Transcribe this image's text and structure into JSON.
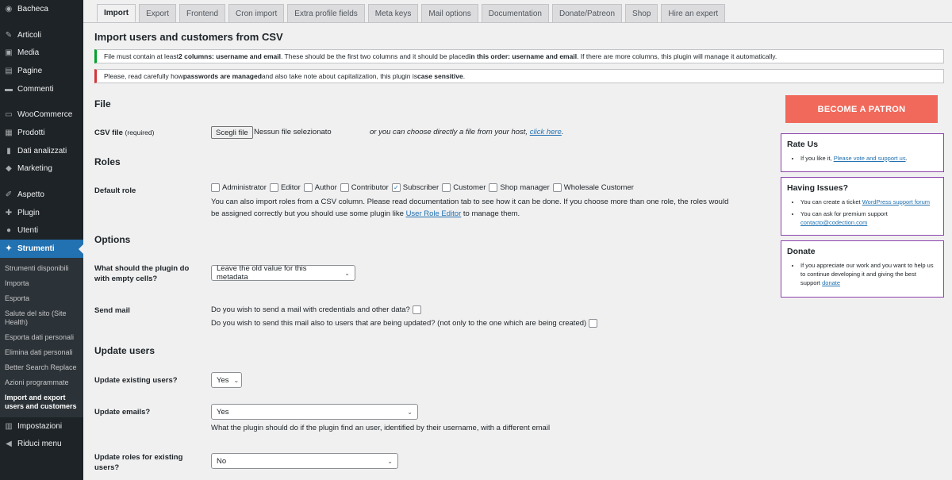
{
  "sidebar": {
    "items": [
      {
        "label": "Bacheca",
        "icon": "dashboard-icon",
        "glyph": "◉"
      },
      {
        "label": "Articoli",
        "icon": "pin-icon",
        "glyph": "✎"
      },
      {
        "label": "Media",
        "icon": "media-icon",
        "glyph": "▣"
      },
      {
        "label": "Pagine",
        "icon": "pages-icon",
        "glyph": "▤"
      },
      {
        "label": "Commenti",
        "icon": "comments-icon",
        "glyph": "▬"
      },
      {
        "label": "WooCommerce",
        "icon": "woocommerce-icon",
        "glyph": "▭"
      },
      {
        "label": "Prodotti",
        "icon": "products-icon",
        "glyph": "▦"
      },
      {
        "label": "Dati analizzati",
        "icon": "analytics-icon",
        "glyph": "▮"
      },
      {
        "label": "Marketing",
        "icon": "marketing-icon",
        "glyph": "◆"
      },
      {
        "label": "Aspetto",
        "icon": "appearance-icon",
        "glyph": "✐"
      },
      {
        "label": "Plugin",
        "icon": "plugin-icon",
        "glyph": "✚"
      },
      {
        "label": "Utenti",
        "icon": "users-icon",
        "glyph": "●"
      },
      {
        "label": "Strumenti",
        "icon": "tools-icon",
        "glyph": "✦"
      },
      {
        "label": "Impostazioni",
        "icon": "settings-icon",
        "glyph": "▥"
      },
      {
        "label": "Riduci menu",
        "icon": "collapse-icon",
        "glyph": "◀"
      }
    ],
    "submenu": [
      "Strumenti disponibili",
      "Importa",
      "Esporta",
      "Salute del sito (Site Health)",
      "Esporta dati personali",
      "Elimina dati personali",
      "Better Search Replace",
      "Azioni programmate",
      "Import and export users and customers"
    ]
  },
  "tabs": [
    "Import",
    "Export",
    "Frontend",
    "Cron import",
    "Extra profile fields",
    "Meta keys",
    "Mail options",
    "Documentation",
    "Donate/Patreon",
    "Shop",
    "Hire an expert"
  ],
  "page": {
    "title": "Import users and customers from CSV",
    "notice1": {
      "a": "File must contain at least ",
      "b": "2 columns: username and email",
      "c": ". These should be the first two columns and it should be placed ",
      "d": "in this order: username and email",
      "e": ". If there are more columns, this plugin will manage it automatically."
    },
    "notice2": {
      "a": "Please, read carefully how ",
      "b": "passwords are managed",
      "c": " and also take note about capitalization, this plugin is ",
      "d": "case sensitive",
      "e": "."
    }
  },
  "file": {
    "section": "File",
    "label": "CSV file",
    "label_required": "(required)",
    "button": "Scegli file",
    "no_file": "Nessun file selezionato",
    "or_host": "or you can choose directly a file from your host, ",
    "click_here": "click here",
    "dot": "."
  },
  "roles": {
    "section": "Roles",
    "label": "Default role",
    "items": [
      {
        "name": "Administrator",
        "checked": false
      },
      {
        "name": "Editor",
        "checked": false
      },
      {
        "name": "Author",
        "checked": false
      },
      {
        "name": "Contributor",
        "checked": false
      },
      {
        "name": "Subscriber",
        "checked": true
      },
      {
        "name": "Customer",
        "checked": false
      },
      {
        "name": "Shop manager",
        "checked": false
      },
      {
        "name": "Wholesale Customer",
        "checked": false
      }
    ],
    "help_line1": "You can also import roles from a CSV column. Please read documentation tab to see how it can be done. If you choose more than one role, the roles would",
    "help_line2a": "be assigned correctly but you should use some plugin like ",
    "help_link": "User Role Editor",
    "help_line2b": " to manage them."
  },
  "options": {
    "section": "Options",
    "empty_label_1": "What should the plugin do",
    "empty_label_2": "with empty cells?",
    "empty_value": "Leave the old value for this metadata",
    "mail_label": "Send mail",
    "mail_q1": "Do you wish to send a mail with credentials and other data?",
    "mail_q2": "Do you wish to send this mail also to users that are being updated? (not only to the one which are being created)"
  },
  "update": {
    "section": "Update users",
    "existing_label": "Update existing users?",
    "existing_value": "Yes",
    "emails_label": "Update emails?",
    "emails_value": "Yes",
    "emails_help": "What the plugin should do if the plugin find an user, identified by their username, with a different email",
    "roles_label_1": "Update roles for existing",
    "roles_label_2": "users?",
    "roles_value": "No"
  },
  "right": {
    "patron": "BECOME A PATRON",
    "rate": {
      "title": "Rate Us",
      "text": "If you like it, ",
      "link": "Please vote and support us",
      "end": "."
    },
    "issues": {
      "title": "Having Issues?",
      "t1": "You can create a ticket ",
      "l1": "WordPress support forum",
      "t2": "You can ask for premium support",
      "l2": "contacto@codection.com"
    },
    "donate": {
      "title": "Donate",
      "text": "If you appreciate our work and you want to help us to continue developing it and giving the best support ",
      "link": "donate"
    }
  },
  "colors": {
    "sidebar": "#1d2327",
    "active": "#2271b1",
    "patron": "#f0695b",
    "box_border": "#8e44ad",
    "notice_green": "#00a32a",
    "notice_red": "#d63638"
  }
}
